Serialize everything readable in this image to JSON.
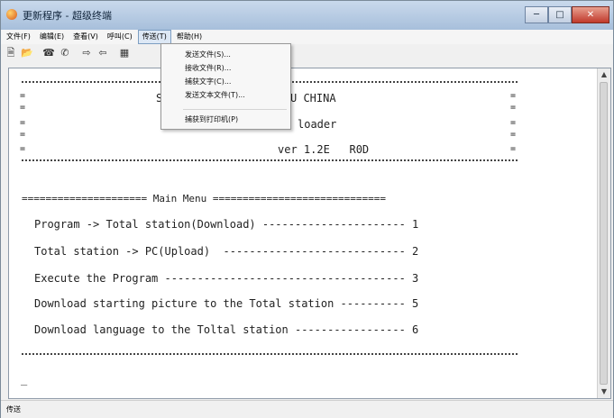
{
  "window": {
    "title": "更新程序 - 超级终端"
  },
  "menu": [
    {
      "label": "文件(F)"
    },
    {
      "label": "编辑(E)"
    },
    {
      "label": "查看(V)"
    },
    {
      "label": "呼叫(C)"
    },
    {
      "label": "传送(T)"
    },
    {
      "label": "帮助(H)"
    }
  ],
  "toolbar": {
    "icons": [
      "new-icon",
      "open-icon",
      "disconnect-icon",
      "dial-icon",
      "send-icon",
      "receive-icon",
      "properties-icon"
    ]
  },
  "dropdown": {
    "items": [
      {
        "label": "发送文件(S)..."
      },
      {
        "label": "接收文件(R)..."
      },
      {
        "label": "捕获文字(C)..."
      },
      {
        "label": "发送文本文件(T)..."
      },
      {
        "label": "捕获到打印机(P)"
      }
    ]
  },
  "terminal": {
    "lines": [
      {
        "text": "="
      },
      {
        "text": "="
      },
      {
        "text": "="
      },
      {
        "text": "="
      },
      {
        "text": "="
      },
      {
        "text": "="
      },
      {
        "text": "="
      },
      {
        "text": "="
      },
      {
        "text": "S"
      },
      {
        "text": "U CHINA"
      },
      {
        "text": "loader"
      },
      {
        "text": "ver 1.2E   R0D"
      },
      {
        "text": "="
      },
      {
        "text": "="
      },
      {
        "text": "="
      },
      {
        "text": "="
      },
      {
        "text": "===================== Main Menu ============================="
      },
      {
        "text": "Program -> Total station(Download) ---------------------- 1"
      },
      {
        "text": "Total station -> PC(Upload)  ---------------------------- 2"
      },
      {
        "text": "Execute the Program ------------------------------------- 3"
      },
      {
        "text": "Download starting picture to the Total station ---------- 5"
      },
      {
        "text": "Download language to the Toltal station ----------------- 6"
      },
      {
        "text": "_"
      }
    ]
  },
  "status": {
    "text": "传送"
  }
}
